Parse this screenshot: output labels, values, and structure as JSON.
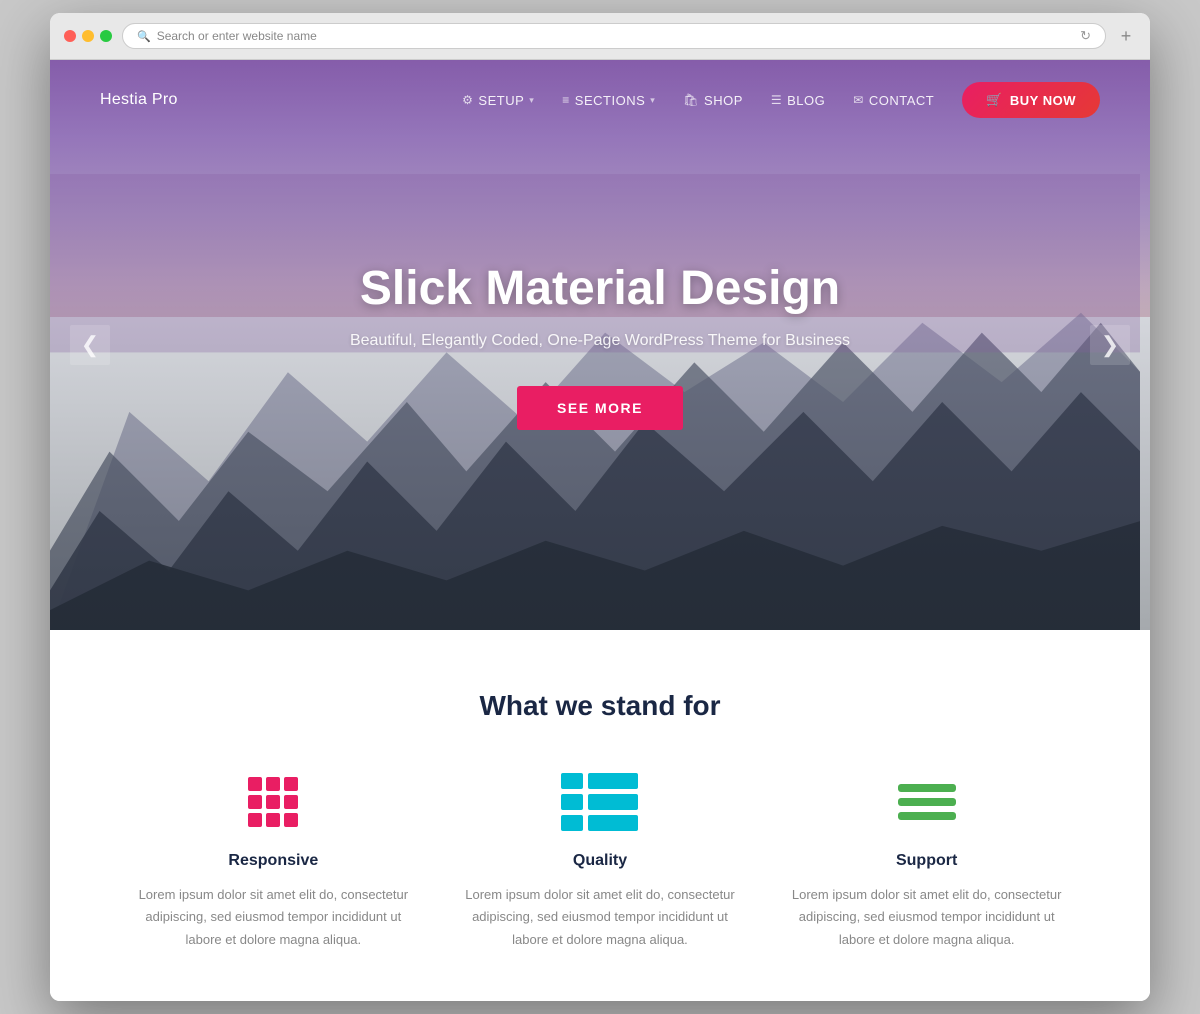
{
  "browser": {
    "search_placeholder": "Search or enter website name"
  },
  "navbar": {
    "brand": "Hestia Pro",
    "links": [
      {
        "id": "setup",
        "label": "SETUP",
        "icon": "⚙",
        "has_caret": true
      },
      {
        "id": "sections",
        "label": "SECTIONS",
        "icon": "≡",
        "has_caret": true
      },
      {
        "id": "shop",
        "label": "SHOP",
        "icon": "🛍",
        "has_caret": false
      },
      {
        "id": "blog",
        "label": "BLOG",
        "icon": "☰",
        "has_caret": false
      },
      {
        "id": "contact",
        "label": "CONTACT",
        "icon": "✉",
        "has_caret": false
      }
    ],
    "buy_button": "BUY NOW",
    "buy_icon": "🛒"
  },
  "hero": {
    "title": "Slick Material Design",
    "subtitle": "Beautiful, Elegantly Coded, One-Page WordPress Theme for Business",
    "cta_label": "SEE MORE",
    "prev_icon": "❮",
    "next_icon": "❯"
  },
  "features": {
    "section_title": "What we stand for",
    "items": [
      {
        "id": "responsive",
        "name": "Responsive",
        "description": "Lorem ipsum dolor sit amet elit do, consectetur adipiscing, sed eiusmod tempor incididunt ut labore et dolore magna aliqua."
      },
      {
        "id": "quality",
        "name": "Quality",
        "description": "Lorem ipsum dolor sit amet elit do, consectetur adipiscing, sed eiusmod tempor incididunt ut labore et dolore magna aliqua."
      },
      {
        "id": "support",
        "name": "Support",
        "description": "Lorem ipsum dolor sit amet elit do, consectetur adipiscing, sed eiusmod tempor incididunt ut labore et dolore magna aliqua."
      }
    ]
  },
  "colors": {
    "accent_pink": "#e91e63",
    "accent_cyan": "#00bcd4",
    "accent_green": "#4caf50",
    "nav_text": "#1a2744",
    "body_text": "#888888"
  }
}
